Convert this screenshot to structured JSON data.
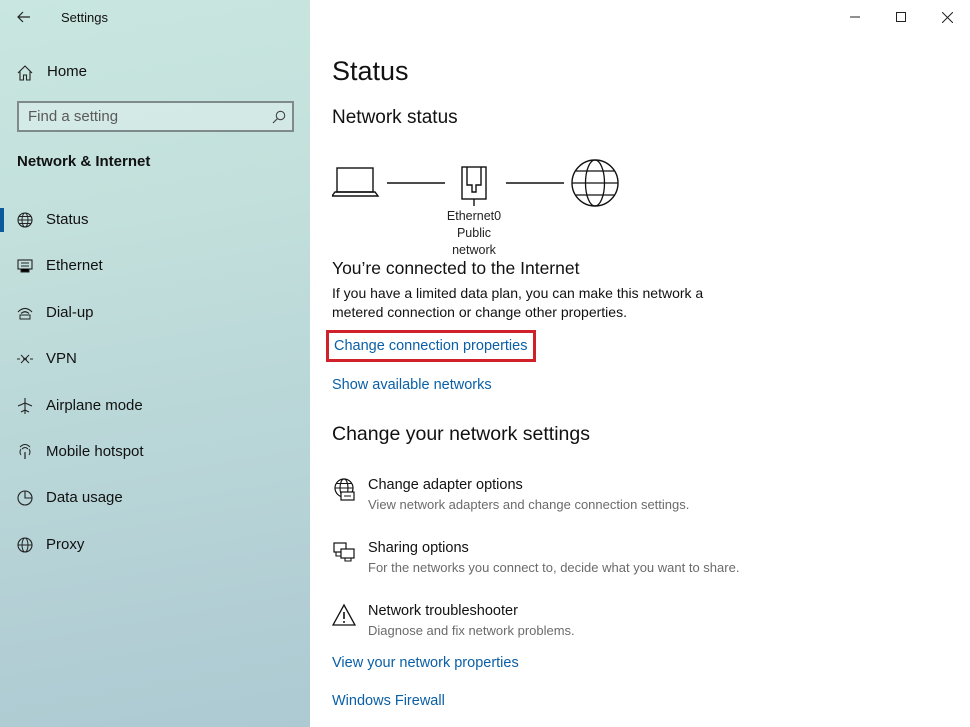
{
  "window": {
    "title": "Settings",
    "controls": {
      "minimize": "minimize",
      "maximize": "maximize",
      "close": "close"
    }
  },
  "sidebar": {
    "home_label": "Home",
    "search_placeholder": "Find a setting",
    "section_title": "Network & Internet",
    "items": [
      {
        "label": "Status",
        "icon": "globe-icon",
        "active": true
      },
      {
        "label": "Ethernet",
        "icon": "ethernet-icon",
        "active": false
      },
      {
        "label": "Dial-up",
        "icon": "dialup-icon",
        "active": false
      },
      {
        "label": "VPN",
        "icon": "vpn-icon",
        "active": false
      },
      {
        "label": "Airplane mode",
        "icon": "airplane-icon",
        "active": false
      },
      {
        "label": "Mobile hotspot",
        "icon": "hotspot-icon",
        "active": false
      },
      {
        "label": "Data usage",
        "icon": "data-usage-icon",
        "active": false
      },
      {
        "label": "Proxy",
        "icon": "proxy-icon",
        "active": false
      }
    ],
    "accent_color": "#0a5a9c"
  },
  "main": {
    "title": "Status",
    "network_status_heading": "Network status",
    "diagram": {
      "adapter_name": "Ethernet0",
      "network_type": "Public network"
    },
    "connected_title": "You’re connected to the Internet",
    "connected_desc": "If you have a limited data plan, you can make this network a metered connection or change other properties.",
    "change_props_link": "Change connection properties",
    "show_networks_link": "Show available networks",
    "settings_heading": "Change your network settings",
    "settings": [
      {
        "name": "Change adapter options",
        "desc": "View network adapters and change connection settings.",
        "icon": "adapter-globe-icon"
      },
      {
        "name": "Sharing options",
        "desc": "For the networks you connect to, decide what you want to share.",
        "icon": "sharing-icon"
      },
      {
        "name": "Network troubleshooter",
        "desc": "Diagnose and fix network problems.",
        "icon": "warning-icon"
      }
    ],
    "view_props_link": "View your network properties",
    "firewall_link": "Windows Firewall",
    "link_color": "#0a5fa6",
    "highlight_color": "#d0202a"
  }
}
